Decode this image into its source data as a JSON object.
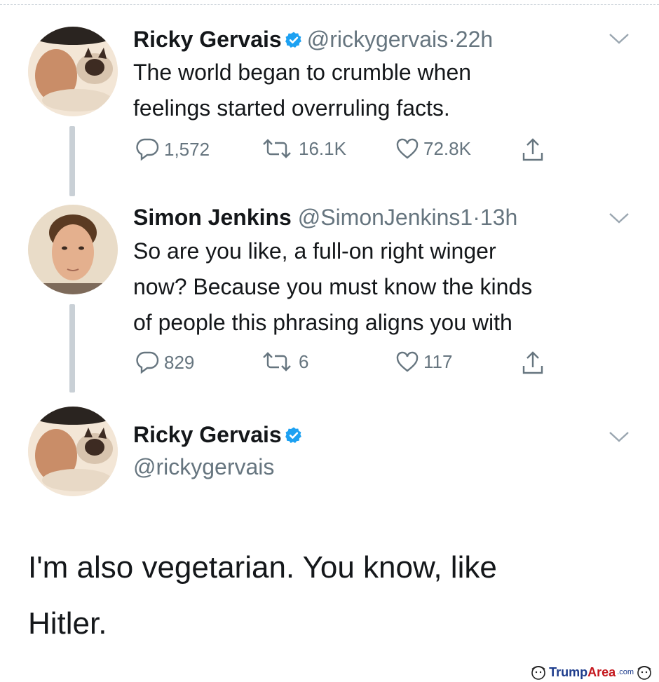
{
  "tweets": [
    {
      "name": "Ricky Gervais",
      "handle": "@rickygervais",
      "dot": "·",
      "time": "22h",
      "text_lines": [
        "The world began to crumble when",
        "feelings started overruling facts."
      ],
      "replies": "1,572",
      "retweets": "16.1K",
      "likes": "72.8K"
    },
    {
      "name": "Simon Jenkins",
      "handle": "@SimonJenkins1",
      "dot": "·",
      "time": "13h",
      "text_lines": [
        "So are you like, a full-on right winger",
        "now? Because you must know the kinds",
        "of people this phrasing aligns you with"
      ],
      "replies": "829",
      "retweets": "6",
      "likes": "117"
    },
    {
      "name": "Ricky Gervais",
      "handle": "@rickygervais",
      "text_lines": [
        "I'm also vegetarian. You know, like",
        "Hitler."
      ]
    }
  ],
  "watermark": {
    "brand_part1": "Trump",
    "brand_part2": "Area",
    "suffix": ".com"
  },
  "colors": {
    "verified": "#1da1f2",
    "secondary_text": "#66757f",
    "thread_line": "#c9d0d6",
    "watermark_blue": "#1d3c8c",
    "watermark_red": "#c4161c"
  },
  "icons": [
    "verified-badge-icon",
    "chevron-down-icon",
    "reply-icon",
    "retweet-icon",
    "like-icon",
    "share-icon"
  ]
}
